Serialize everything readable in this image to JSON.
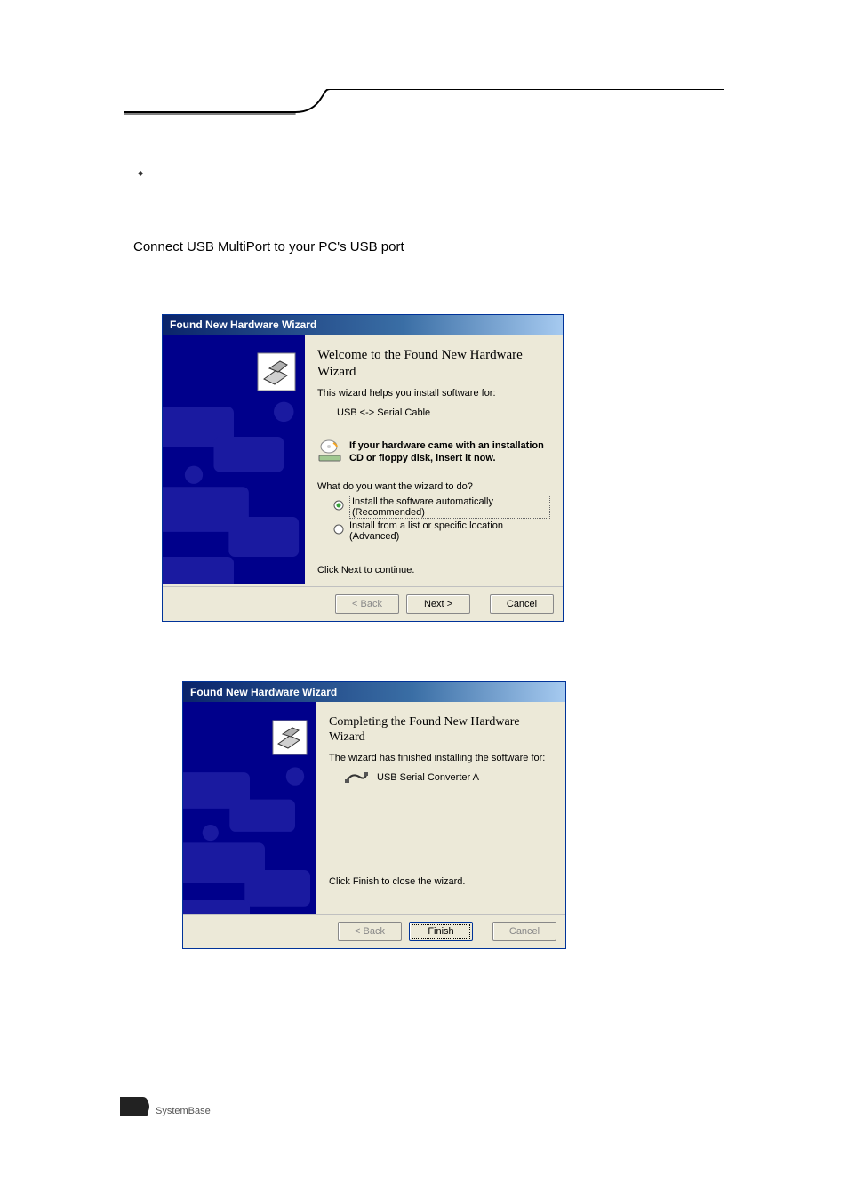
{
  "page": {
    "bullet_glyph": "◆",
    "bullet_text": "",
    "connect_line": "Connect USB MultiPort to your PC's USB port",
    "instr1_prefix": "\"",
    "instr1_mid": "\"",
    "instr1_q1": "\"",
    "instr1_q2": "\"",
    "instr2_q1": "\"",
    "instr2_q2": "\"",
    "bottom_q1": "\"",
    "bottom_q2": "\"",
    "footer_brand": "SystemBase"
  },
  "dialog1": {
    "title": "Found New Hardware Wizard",
    "heading": "Welcome to the Found New Hardware Wizard",
    "help_line": "This wizard helps you install software for:",
    "device": "USB <-> Serial Cable",
    "insert_text": "If your hardware came with an installation CD or floppy disk, insert it now.",
    "question": "What do you want the wizard to do?",
    "radio_auto": "Install the software automatically (Recommended)",
    "radio_list": "Install from a list or specific location (Advanced)",
    "continue": "Click Next to continue.",
    "back": "< Back",
    "next": "Next >",
    "cancel": "Cancel"
  },
  "dialog2": {
    "title": "Found New Hardware Wizard",
    "heading": "Completing the Found New Hardware Wizard",
    "done_line": "The wizard has finished installing the software for:",
    "device": "USB Serial Converter A",
    "close_line": "Click Finish to close the wizard.",
    "back": "< Back",
    "finish": "Finish",
    "cancel": "Cancel"
  }
}
